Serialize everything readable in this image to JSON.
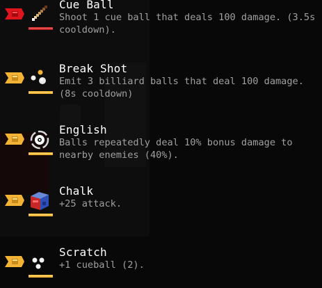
{
  "colors": {
    "background": "#080808",
    "title_text": "#ffffff",
    "description_text": "#a0a0a0",
    "tag_selected": "#e0141c",
    "tag_default": "#f3b334",
    "underline_selected": "#c62828",
    "underline_default": "#f3b334"
  },
  "upgrades": [
    {
      "title": "Cue Ball",
      "description": "Shoot 1 cue ball that deals 100 damage. (3.5s cooldown).",
      "icon": "cue-stick-icon",
      "selected": true
    },
    {
      "title": "Break Shot",
      "description": "Emit 3 billiard balls that deal 100 damage. (8s cooldown)",
      "icon": "billiard-balls-icon",
      "selected": false
    },
    {
      "title": "English",
      "description": "Balls repeatedly deal 10% bonus damage to nearby enemies (40%).",
      "icon": "spin-ball-icon",
      "selected": false
    },
    {
      "title": "Chalk",
      "description": "+25 attack.",
      "icon": "chalk-cube-icon",
      "selected": false
    },
    {
      "title": "Scratch",
      "description": "+1 cueball (2).",
      "icon": "three-balls-icon",
      "selected": false
    }
  ]
}
